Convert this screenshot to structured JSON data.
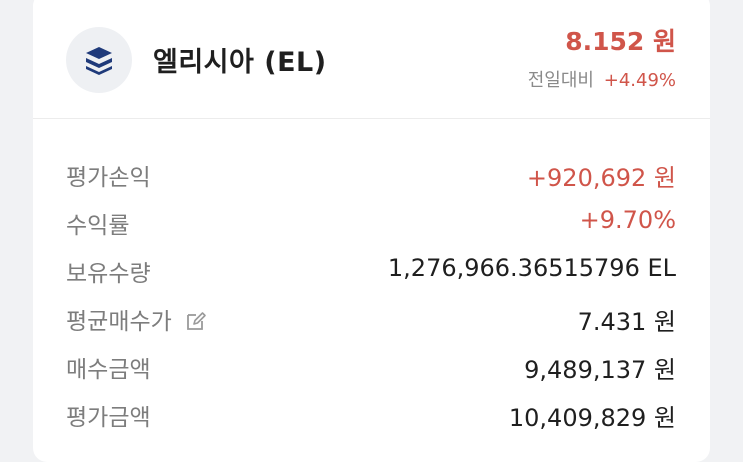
{
  "coin": {
    "name": "엘리시아 (EL)",
    "logo_icon": "elysia-stack-logo",
    "price": "8.152 원",
    "change_label": "전일대비",
    "change_value": "+4.49%"
  },
  "colors": {
    "up": "#d0554a",
    "logo_blue": "#1f3a7a"
  },
  "details": [
    {
      "label": "평가손익",
      "value": "+920,692 원",
      "tone": "red"
    },
    {
      "label": "수익률",
      "value": "+9.70%",
      "tone": "red"
    },
    {
      "label": "보유수량",
      "value": "1,276,966.36515796 EL",
      "tone": "normal"
    },
    {
      "label": "평균매수가",
      "value": "7.431 원",
      "tone": "normal",
      "icon": "edit-icon"
    },
    {
      "label": "매수금액",
      "value": "9,489,137 원",
      "tone": "normal"
    },
    {
      "label": "평가금액",
      "value": "10,409,829 원",
      "tone": "normal"
    }
  ]
}
